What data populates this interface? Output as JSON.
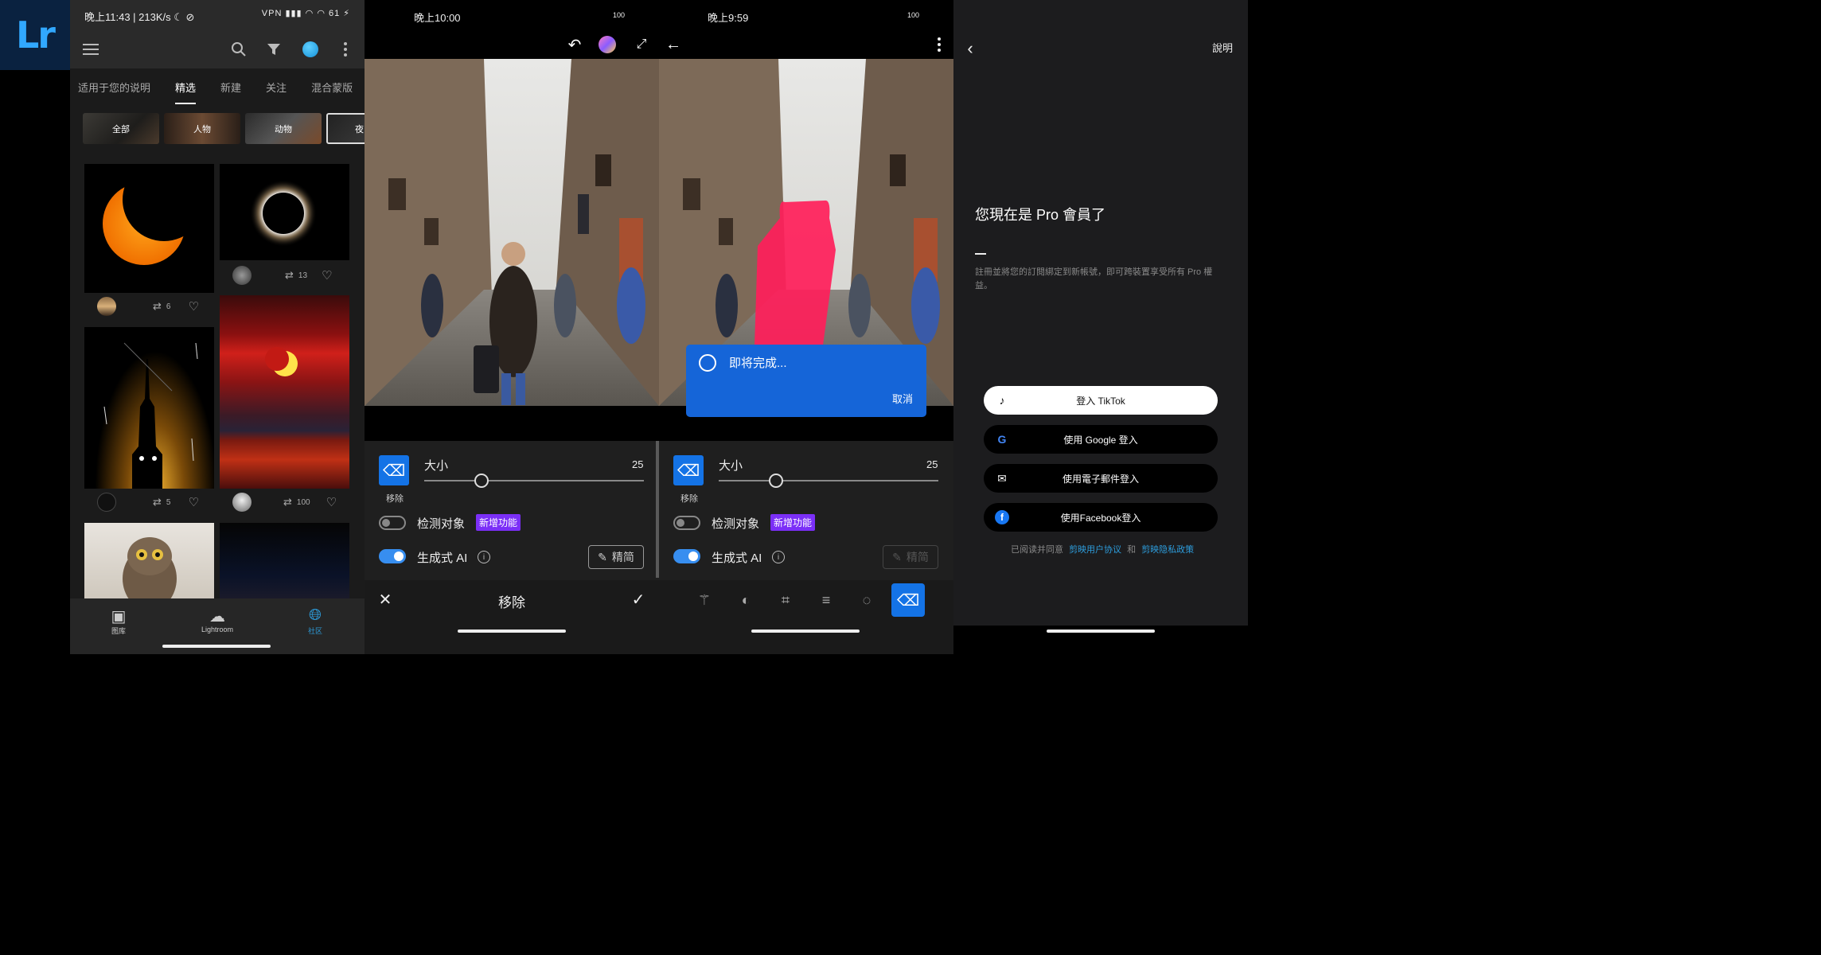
{
  "logo": {
    "text": "Lr"
  },
  "community": {
    "status": {
      "time": "晚上11:43 | 213K/s ☾ ⊘",
      "icons": "VPN ▮▮▮ ◠ ◠ 61 ⚡"
    },
    "tabs": [
      "适用于您的说明",
      "精选",
      "新建",
      "关注",
      "混合蒙版"
    ],
    "active_tab": "精选",
    "chips": [
      "全部",
      "人物",
      "动物",
      "夜"
    ],
    "posts": [
      {
        "remix_count": "6"
      },
      {
        "remix_count": "13"
      },
      {
        "remix_count": "5"
      },
      {
        "remix_count": "100"
      }
    ],
    "nav": [
      {
        "label": "图库",
        "icon": "photo-library-icon"
      },
      {
        "label": "Lightroom",
        "icon": "cloud-photo-icon"
      },
      {
        "label": "社区",
        "icon": "globe-icon"
      }
    ]
  },
  "editor_left": {
    "status": {
      "time": "晚上10:00",
      "icons": "100"
    },
    "size_label": "大小",
    "size_value": "25",
    "tool_label": "移除",
    "detect_label": "检测对象",
    "new_badge": "新增功能",
    "genai_label": "生成式 AI",
    "refine_label": "精简",
    "bottom_title": "移除"
  },
  "editor_right": {
    "status": {
      "time": "晚上9:59",
      "icons": "100"
    },
    "size_label": "大小",
    "size_value": "25",
    "tool_label": "移除",
    "detect_label": "检测对象",
    "new_badge": "新增功能",
    "genai_label": "生成式 AI",
    "refine_label": "精简"
  },
  "slider": {
    "size_fraction": 0.26
  },
  "toggles": {
    "detect_objects": false,
    "generative_ai": true
  },
  "dialog": {
    "message": "即将完成...",
    "cancel": "取消"
  },
  "login": {
    "help": "說明",
    "title": "您現在是 Pro 會員了",
    "desc": "註冊並將您的訂閱綁定到新帳號，即可跨裝置享受所有 Pro 權益。",
    "buttons": [
      "登入 TikTok",
      "使用 Google 登入",
      "使用電子郵件登入",
      "使用Facebook登入"
    ],
    "agree_prefix": "已阅读并同意",
    "agree_link1": "剪映用户协议",
    "agree_and": "和",
    "agree_link2": "剪映隐私政策"
  },
  "colors": {
    "accent": "#1473e6",
    "toggle_on": "#378ef0",
    "badge": "#7b2ff7",
    "dialog": "#1565d8",
    "link": "#2d9cdb"
  }
}
